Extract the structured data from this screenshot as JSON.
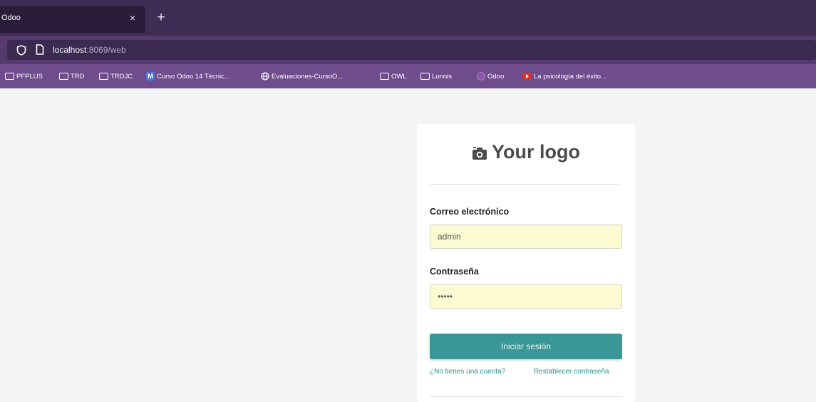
{
  "browser": {
    "tab_title": "Odoo",
    "tab_close": "×",
    "new_tab": "+",
    "url_host": "localhost",
    "url_rest": ":8069/web"
  },
  "bookmarks": [
    {
      "label": "PFPLUS",
      "icon": "folder-icon"
    },
    {
      "label": "TRD",
      "icon": "folder-icon"
    },
    {
      "label": "TRDJC",
      "icon": "folder-icon"
    },
    {
      "label": "Curso Odoo 14 Técnic...",
      "icon": "m-icon"
    },
    {
      "label": "Evaluaciones-CursoO...",
      "icon": "globe-icon"
    },
    {
      "label": "OWL",
      "icon": "folder-icon"
    },
    {
      "label": "Lonnis",
      "icon": "folder-icon"
    },
    {
      "label": "Odoo",
      "icon": "odoo-icon"
    },
    {
      "label": "La psicología del éxito...",
      "icon": "youtube-icon"
    }
  ],
  "login": {
    "logo_text": "Your logo",
    "email_label": "Correo electrónico",
    "email_value": "admin",
    "password_label": "Contraseña",
    "password_value": "admin",
    "submit_label": "Iniciar sesión",
    "signup_link": "¿No tienes una cuenta?",
    "reset_link": "Restablecer contraseña"
  },
  "colors": {
    "tabbar": "#3f2c55",
    "urlbar_row": "#553a70",
    "bookmarks_bar": "#6f4c8c",
    "primary_button": "#3a9797",
    "input_autofill": "#fdfbd2",
    "link": "#2e8f8f"
  }
}
